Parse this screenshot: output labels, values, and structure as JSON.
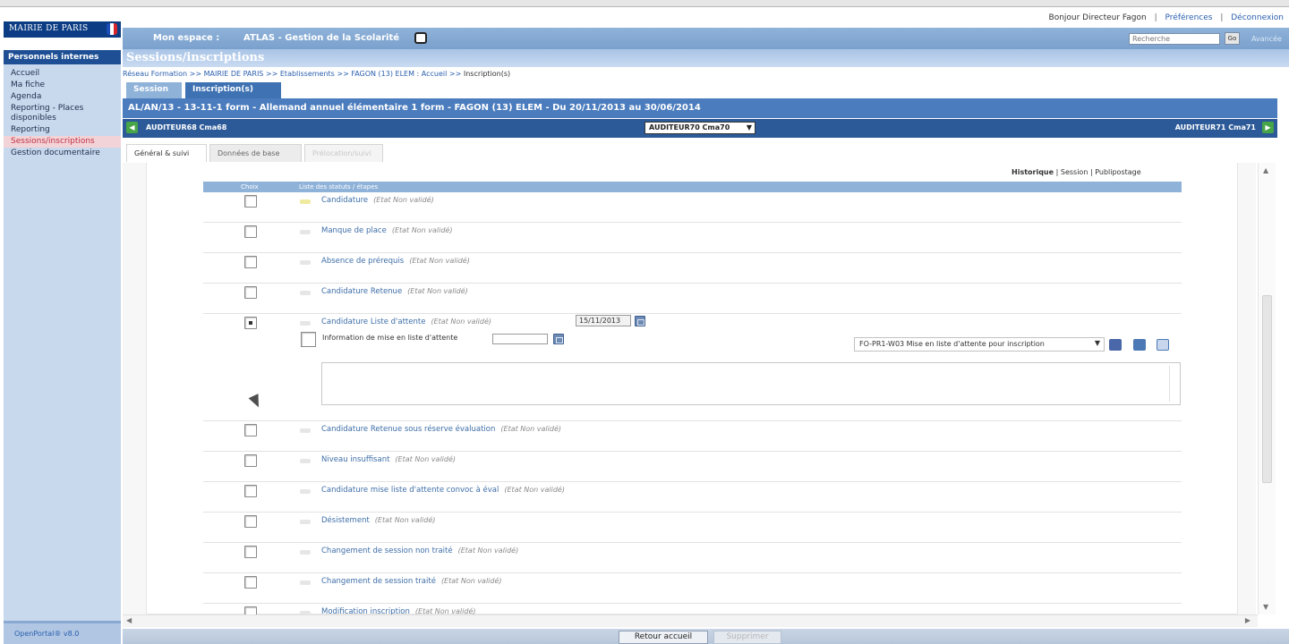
{
  "logo": {
    "text": "MAIRIE DE PARIS"
  },
  "userbar": {
    "greeting": "Bonjour Directeur Fagon",
    "preferences": "Préférences",
    "logout": "Déconnexion"
  },
  "topnav": {
    "mon_espace": "Mon espace :",
    "atlas": "ATLAS - Gestion de la Scolarité",
    "search_placeholder": "Recherche",
    "search_button": "Go",
    "advanced": "Avancée"
  },
  "sidebar": {
    "header": "Personnels internes",
    "items": [
      {
        "label": "Accueil"
      },
      {
        "label": "Ma fiche"
      },
      {
        "label": "Agenda"
      },
      {
        "label": "Reporting - Places disponibles"
      },
      {
        "label": "Reporting"
      },
      {
        "label": "Sessions/inscriptions"
      },
      {
        "label": "Gestion documentaire"
      }
    ],
    "footer": "OpenPortal® v8.0"
  },
  "page": {
    "title": "Sessions/inscriptions"
  },
  "breadcrumb": {
    "path": "Réseau Formation >> MAIRIE DE PARIS >> Etablissements >> FAGON (13) ELEM : Accueil >> ",
    "current": "Inscription(s)"
  },
  "tabs": [
    {
      "label": "Session"
    },
    {
      "label": "Inscription(s)"
    }
  ],
  "session_bar": {
    "title": "AL/AN/13 - 13-11-1 form - Allemand annuel élémentaire 1 form - FAGON (13) ELEM - Du 20/11/2013 au 30/06/2014"
  },
  "auditor_bar": {
    "prev": "AUDITEUR68 Cma68",
    "selected": "AUDITEUR70 Cma70",
    "next": "AUDITEUR71 Cma71"
  },
  "subtabs": [
    {
      "label": "Général & suivi"
    },
    {
      "label": "Données de base"
    },
    {
      "label": "Prélocation/suivi"
    }
  ],
  "links": {
    "historique": "Historique",
    "session": "Session",
    "publipostage": "Publipostage"
  },
  "table": {
    "col_choix": "Choix",
    "col_statuts": "Liste des statuts / étapes",
    "rows": [
      {
        "label": "Candidature",
        "state": "(Etat Non validé)",
        "indicator": "yellow"
      },
      {
        "label": "Manque de place",
        "state": "(Etat Non validé)"
      },
      {
        "label": "Absence de prérequis",
        "state": "(Etat Non validé)"
      },
      {
        "label": "Candidature Retenue",
        "state": "(Etat Non validé)"
      },
      {
        "label": "Candidature Liste d'attente",
        "state": "(Etat Non validé)",
        "date": "15/11/2013",
        "checked": true
      },
      {
        "label": "Candidature Retenue sous réserve évaluation",
        "state": "(Etat Non validé)"
      },
      {
        "label": "Niveau insuffisant",
        "state": "(Etat Non validé)"
      },
      {
        "label": "Candidature mise liste d'attente convoc à éval",
        "state": "(Etat Non validé)"
      },
      {
        "label": "Désistement",
        "state": "(Etat Non validé)"
      },
      {
        "label": "Changement de session non traité",
        "state": "(Etat Non validé)"
      },
      {
        "label": "Changement de session traité",
        "state": "(Etat Non validé)"
      },
      {
        "label": "Modification inscription",
        "state": "(Etat Non validé)"
      }
    ]
  },
  "waitlist": {
    "info_label": "Information de mise en liste d'attente",
    "model_select": "FO-PR1-W03 Mise en liste d'attente pour inscription"
  },
  "bottom": {
    "back": "Retour accueil",
    "delete": "Supprimer"
  }
}
